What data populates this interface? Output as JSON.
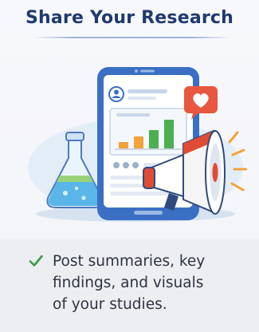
{
  "header": {
    "title": "Share Your Research"
  },
  "illustration": {
    "icons": [
      "phone-icon",
      "profile-icon",
      "bar-chart-icon",
      "heart-notification-icon",
      "megaphone-icon",
      "flask-icon"
    ],
    "colors": {
      "phone_frame": "#3a6fc4",
      "bar_green": "#4caf50",
      "bar_orange": "#f2a33a",
      "heart_badge": "#e8573f",
      "megaphone_red": "#e04b35",
      "flask_liquid": "#5ab6e8"
    }
  },
  "feature": {
    "check_icon": "checkmark-icon",
    "check_color": "#3c9a47",
    "text": "Post summaries, key\nfindings, and visuals\nof your studies."
  }
}
